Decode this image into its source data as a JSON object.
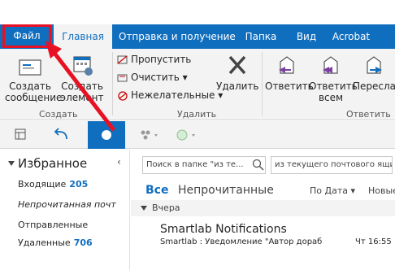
{
  "ribbon_tabs": {
    "file": "Файл",
    "home": "Главная",
    "send_receive": "Отправка и получение",
    "folder": "Папка",
    "view": "Вид",
    "acrobat": "Acrobat"
  },
  "ribbon": {
    "new_email_line1": "Создать",
    "new_email_line2": "сообщение",
    "new_items_line1": "Создать",
    "new_items_line2": "элемент",
    "group_create": "Создать",
    "ignore": "Пропустить",
    "cleanup": "Очистить",
    "junk": "Нежелательные",
    "delete": "Удалить",
    "group_delete": "Удалить",
    "reply": "Ответить",
    "reply_all_line1": "Ответить",
    "reply_all_line2": "всем",
    "forward": "Переслат",
    "group_respond": "Ответить"
  },
  "folders": {
    "favorites_title": "Избранное",
    "items": [
      {
        "label": "Входящие",
        "count": "205"
      },
      {
        "label": "Непрочитанная почт",
        "count": ""
      },
      {
        "label": "Отправленные",
        "count": ""
      },
      {
        "label": "Удаленные",
        "count": "706"
      }
    ]
  },
  "mail": {
    "search_placeholder": "Поиск в папке \"из те...",
    "scope": "из текущего почтового ящи",
    "filter_all": "Все",
    "filter_unread": "Непрочитанные",
    "sort_by": "По Дата",
    "newest": "Новые",
    "group_header": "Вчера",
    "message": {
      "from": "Smartlab Notifications",
      "subject": "Smartlab : Уведомление \"Автор дораб",
      "time": "Чт 16:55"
    }
  },
  "colors": {
    "accent": "#106ebe",
    "highlight_red": "#e81123"
  }
}
